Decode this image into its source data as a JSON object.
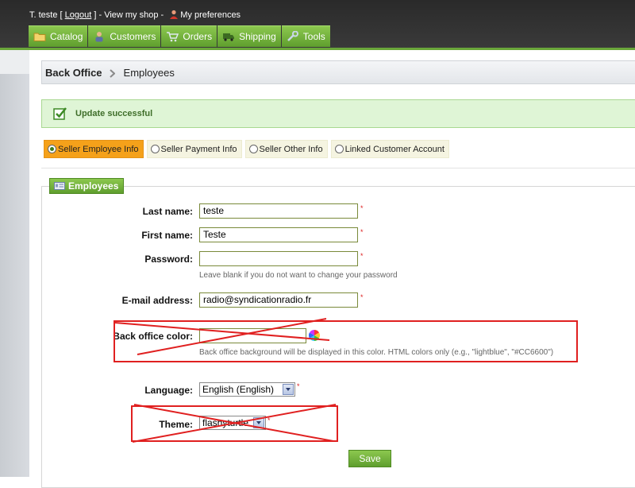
{
  "header": {
    "user_name": "T. teste",
    "logout_prefix": " [ ",
    "logout_label": "Logout",
    "logout_suffix": " ] - ",
    "view_shop_label": "View my shop",
    "view_shop_sep": " - ",
    "preferences_label": "My preferences"
  },
  "tabs": [
    {
      "label": "Catalog",
      "icon": "folder-icon"
    },
    {
      "label": "Customers",
      "icon": "customer-icon"
    },
    {
      "label": "Orders",
      "icon": "cart-icon"
    },
    {
      "label": "Shipping",
      "icon": "truck-icon"
    },
    {
      "label": "Tools",
      "icon": "wrench-icon"
    }
  ],
  "breadcrumb": {
    "root": "Back Office",
    "current": "Employees"
  },
  "message": {
    "text": "Update successful"
  },
  "subtabs": [
    {
      "label": "Seller Employee Info",
      "active": true
    },
    {
      "label": "Seller Payment Info",
      "active": false
    },
    {
      "label": "Seller Other Info",
      "active": false
    },
    {
      "label": "Linked Customer Account",
      "active": false
    }
  ],
  "form": {
    "legend": "Employees",
    "last_name": {
      "label": "Last name:",
      "value": "teste"
    },
    "first_name": {
      "label": "First name:",
      "value": "Teste"
    },
    "password": {
      "label": "Password:",
      "value": "",
      "hint": "Leave blank if you do not want to change your password"
    },
    "email": {
      "label": "E-mail address:",
      "value": "radio@syndicationradio.fr"
    },
    "bo_color": {
      "label": "Back office color:",
      "value": "",
      "hint": "Back office background will be displayed in this color. HTML colors only (e.g., \"lightblue\", \"#CC6600\")"
    },
    "language": {
      "label": "Language:",
      "value": "English (English)"
    },
    "theme": {
      "label": "Theme:",
      "value": "flashyturtle"
    },
    "required_mark": "*",
    "save_label": "Save"
  },
  "colors": {
    "tab_green": "#6aa63a",
    "active_subtab": "#f5a11a",
    "success_bg": "#dff5d6",
    "annotation_red": "#e02020"
  }
}
